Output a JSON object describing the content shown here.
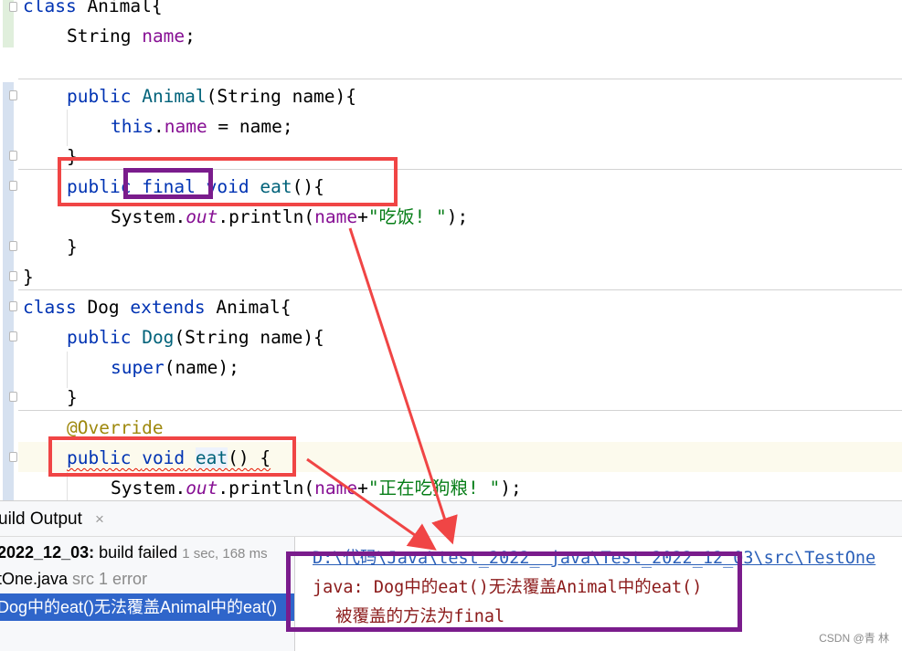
{
  "editor": {
    "lines": {
      "l1": {
        "kw": "class",
        "rest": " Animal{"
      },
      "l2": {
        "type": "String",
        "sp": " ",
        "field": "name",
        "end": ";"
      },
      "l4": {
        "kw": "public",
        "sp": " ",
        "ctor": "Animal",
        "rest": "(String name){"
      },
      "l5": {
        "kw": "this",
        "dot": ".",
        "field": "name",
        "rest": " = name;"
      },
      "l6": {
        "text": "}"
      },
      "l7": {
        "kw1": "public",
        "sp1": " ",
        "kw2": "final",
        "sp2": " ",
        "kw3": "void",
        "sp3": " ",
        "method": "eat",
        "rest": "(){"
      },
      "l8": {
        "pre": "System.",
        "out": "out",
        "mid": ".println(",
        "field": "name",
        "plus": "+",
        "str": "\"吃饭! \"",
        "end": ");"
      },
      "l9": {
        "text": "}"
      },
      "l10": {
        "text": "}"
      },
      "l11": {
        "kw1": "class",
        "mid": " Dog ",
        "kw2": "extends",
        "rest": " Animal{"
      },
      "l12": {
        "kw": "public",
        "sp": " ",
        "ctor": "Dog",
        "rest": "(String name){"
      },
      "l13": {
        "kw": "super",
        "rest": "(name);"
      },
      "l14": {
        "text": "}"
      },
      "l15": {
        "ann": "@Override"
      },
      "l16": {
        "kw1": "public",
        "sp1": " ",
        "kw2": "void",
        "sp2": " ",
        "method": "eat",
        "rest": "() {"
      },
      "l17": {
        "pre": "System.",
        "out": "out",
        "mid": ".println(",
        "field": "name",
        "plus": "+",
        "str": "\"正在吃狗粮! \"",
        "end": ");"
      }
    }
  },
  "build": {
    "tab_label": "uild Output",
    "close_glyph": "×",
    "tree": {
      "row1_name": "2022_12_03:",
      "row1_status": " build failed ",
      "row1_time": "1 sec, 168 ms",
      "row2_file": "tOne.java",
      "row2_meta": " src 1 error",
      "row3_text": "Dog中的eat()无法覆盖Animal中的eat()"
    },
    "console": {
      "path": "D:\\代码\\Java\\test_2022_ java\\Test_2022_12_03\\src\\TestOne",
      "error_line1": "java: Dog中的eat()无法覆盖Animal中的eat()",
      "error_line2": "被覆盖的方法为final"
    }
  },
  "watermark": "CSDN @青 林",
  "colors": {
    "keyword": "#0033b3",
    "field": "#871094",
    "string": "#067d17",
    "annotation": "#9e880d",
    "red_annotation": "#f04545",
    "purple_annotation": "#7a1c8c",
    "selection": "#2f65ca"
  }
}
